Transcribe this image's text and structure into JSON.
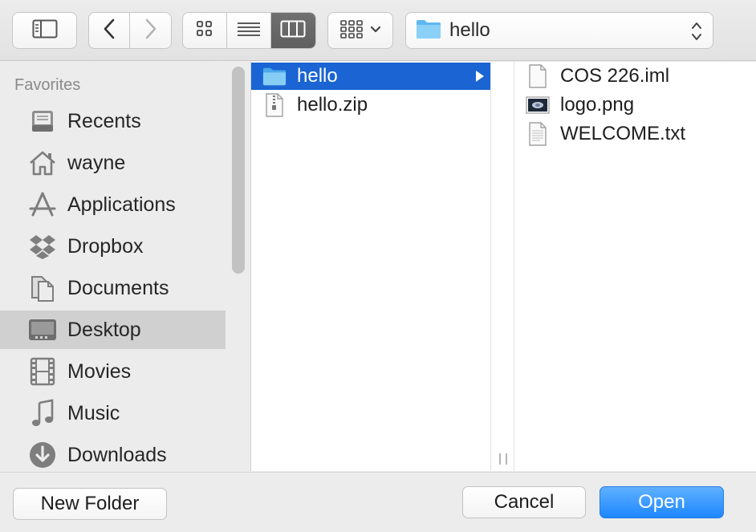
{
  "toolbar": {
    "path_label": "hello"
  },
  "sidebar": {
    "heading": "Favorites",
    "items": [
      {
        "label": "Recents",
        "icon": "recents-icon"
      },
      {
        "label": "wayne",
        "icon": "home-icon"
      },
      {
        "label": "Applications",
        "icon": "applications-icon"
      },
      {
        "label": "Dropbox",
        "icon": "dropbox-icon"
      },
      {
        "label": "Documents",
        "icon": "documents-icon"
      },
      {
        "label": "Desktop",
        "icon": "desktop-icon",
        "selected": true
      },
      {
        "label": "Movies",
        "icon": "movies-icon"
      },
      {
        "label": "Music",
        "icon": "music-icon"
      },
      {
        "label": "Downloads",
        "icon": "downloads-icon"
      }
    ]
  },
  "columns": {
    "col1": [
      {
        "label": "hello",
        "icon": "folder-icon",
        "selected": true
      },
      {
        "label": "hello.zip",
        "icon": "zip-file-icon"
      }
    ],
    "col2": [
      {
        "label": "COS 226.iml",
        "icon": "document-icon"
      },
      {
        "label": "logo.png",
        "icon": "image-thumbnail-icon"
      },
      {
        "label": "WELCOME.txt",
        "icon": "text-file-icon"
      }
    ]
  },
  "buttons": {
    "new_folder": "New Folder",
    "cancel": "Cancel",
    "open": "Open"
  },
  "colors": {
    "selection": "#1a64d3",
    "primary_button": "#1e87ff",
    "folder": "#5fb8f0"
  }
}
